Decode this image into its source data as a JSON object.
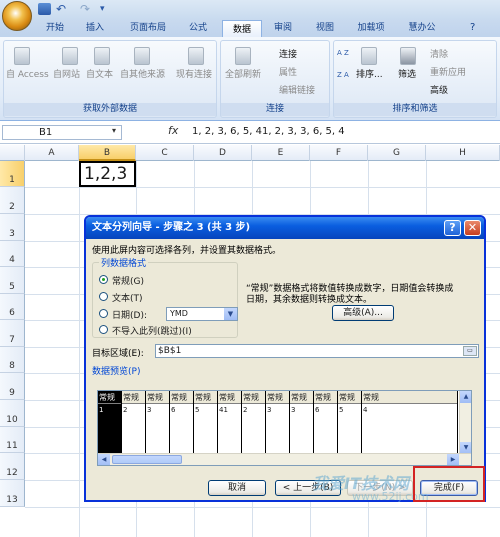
{
  "tabs": [
    "开始",
    "插入",
    "页面布局",
    "公式",
    "数据",
    "审阅",
    "视图",
    "加载项",
    "慧办公"
  ],
  "active_tab": "数据",
  "ribbon": {
    "ext_data": {
      "title": "获取外部数据",
      "items": [
        "自 Access",
        "自网站",
        "自文本",
        "自其他来源",
        "现有连接"
      ]
    },
    "connections": {
      "title": "连接",
      "refresh_all": "全部刷新",
      "connections": "连接",
      "properties": "属性",
      "edit_links": "编辑链接"
    },
    "sort_filter": {
      "title": "排序和筛选",
      "sort": "排序...",
      "filter": "筛选",
      "clear": "清除",
      "reapply": "重新应用",
      "advanced": "高级",
      "az": "A Z",
      "za": "Z A"
    }
  },
  "namebox": "B1",
  "fx": "fx",
  "formula": "1, 2, 3, 6, 5, 41, 2, 3, 3, 6, 5, 4",
  "columns": [
    "A",
    "B",
    "C",
    "D",
    "E",
    "F",
    "G",
    "H"
  ],
  "rows": [
    "1",
    "2",
    "3",
    "4",
    "5",
    "6",
    "7",
    "8",
    "9",
    "10",
    "11",
    "12",
    "13"
  ],
  "cell_b1": "1,2,3",
  "dialog": {
    "title": "文本分列向导 - 步骤之 3 (共 3 步)",
    "help": "?",
    "close": "✕",
    "intro": "使用此屏内容可选择各列，并设置其数据格式。",
    "format_legend": "列数据格式",
    "options": [
      "常规(G)",
      "文本(T)",
      "日期(D):",
      "不导入此列(跳过)(I)"
    ],
    "date_value": "YMD",
    "note_line1": "“常规”数据格式将数值转换成数字，日期值会转换成",
    "note_line2": "日期，其余数据则转换成文本。",
    "advanced": "高级(A)...",
    "target_label": "目标区域(E):",
    "target_value": "$B$1",
    "preview_label": "数据预览(P)",
    "preview_header": "常规",
    "preview_values": [
      "1",
      "2",
      "3",
      "6",
      "5",
      "41",
      "2",
      "3",
      "3",
      "6",
      "5",
      "4"
    ],
    "cancel": "取消",
    "back": "< 上一步(B)",
    "next": "下一步(N) >",
    "finish": "完成(F)"
  },
  "watermark": "我爱IT技术网",
  "watermark_url": "www.52ij.com"
}
